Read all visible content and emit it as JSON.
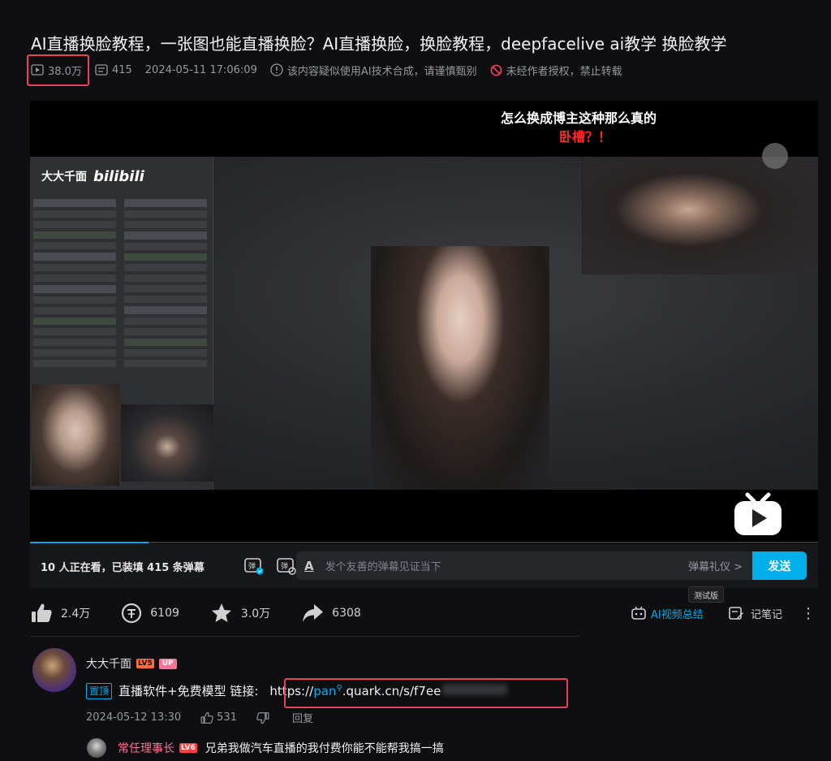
{
  "video": {
    "title": "AI直播换脸教程，一张图也能直播换脸？AI直播换脸，换脸教程，deepfacelive ai教学 换脸教学",
    "views": "38.0万",
    "danmaku_count": "415",
    "published": "2024-05-11 17:06:09",
    "ai_notice": "该内容疑似使用AI技术合成，请谨慎甄别",
    "copyright": "未经作者授权，禁止转载"
  },
  "player": {
    "caption_line1": "怎么换成博主这种那么真的",
    "caption_line2": "卧槽？！",
    "software_brand": "大大千面",
    "software_logo": "bilibili",
    "progress_fraction": 0.15
  },
  "danmaku_bar": {
    "viewers": "10 人正在看，已装填 415 条弹幕",
    "placeholder": "发个友善的弹幕见证当下",
    "etiquette": "弹幕礼仪 >",
    "send": "发送"
  },
  "actions": {
    "like": "2.4万",
    "coin": "6109",
    "favorite": "3.0万",
    "share": "6308",
    "ai_summary": "AI视频总结",
    "test_badge": "测试版",
    "notes": "记笔记"
  },
  "comment": {
    "user": "大大千面",
    "level": "LV5",
    "up_badge": "UP",
    "pinned": "置顶",
    "text": "直播软件+免费模型 链接: ",
    "link_prefix": "https://",
    "link_pan": "pan",
    "link_rest": ".quark.cn/s/f7ee",
    "time": "2024-05-12 13:30",
    "likes": "531",
    "reply": "回复"
  },
  "reply": {
    "user": "常任理事长",
    "level": "LV6",
    "text": "兄弟我做汽车直播的我付费你能不能帮我搞一搞"
  },
  "colors": {
    "accent": "#00aeec",
    "highlight_box": "#e9425b",
    "up_pink": "#fb7299"
  }
}
